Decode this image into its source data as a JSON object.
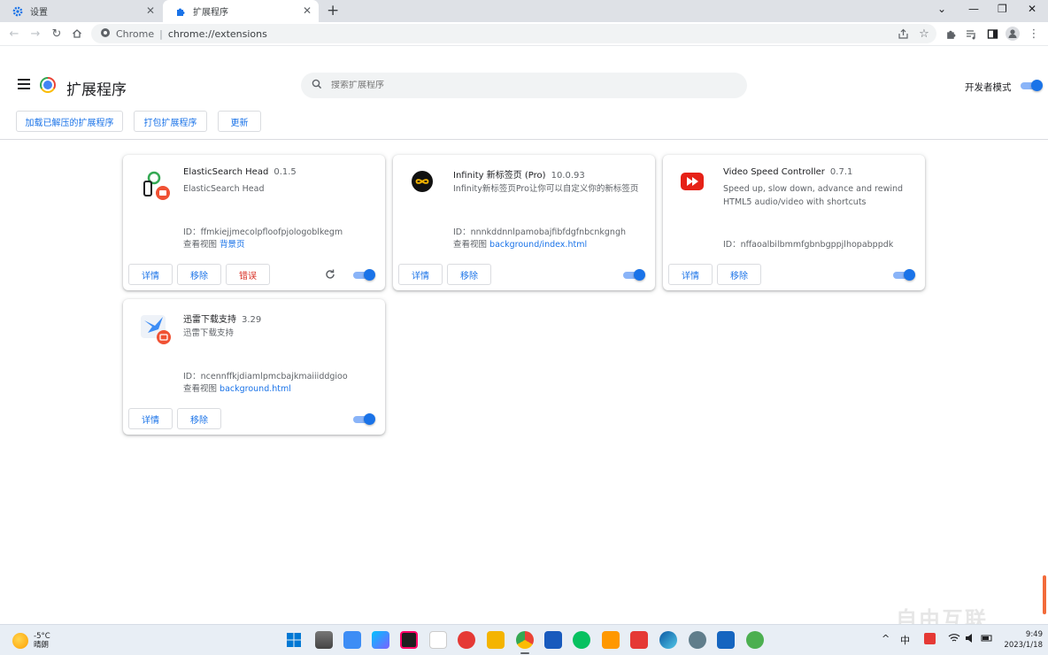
{
  "tabs": [
    {
      "label": "设置",
      "icon": "gear-icon"
    },
    {
      "label": "扩展程序",
      "icon": "puzzle-icon"
    }
  ],
  "omnibox": {
    "origin": "Chrome",
    "url": "chrome://extensions"
  },
  "header": {
    "title": "扩展程序",
    "search_placeholder": "搜索扩展程序",
    "dev_mode_label": "开发者模式",
    "dev_mode_on": true
  },
  "dev_toolbar": {
    "load_unpacked": "加载已解压的扩展程序",
    "pack": "打包扩展程序",
    "update": "更新"
  },
  "extensions": [
    {
      "name": "ElasticSearch Head",
      "version": "0.1.5",
      "description": "ElasticSearch Head",
      "id": "ID：ffmkiejjmecolpfloofpjologoblkegm",
      "views_label": "查看视图",
      "view_link": "背景页",
      "details": "详情",
      "remove": "移除",
      "errors": "错误",
      "enabled": true
    },
    {
      "name": "Infinity 新标签页 (Pro)",
      "version": "10.0.93",
      "description": "Infinity新标签页Pro让你可以自定义你的新标签页",
      "id": "ID：nnnkddnnlpamobajfibfdgfnbcnkgngh",
      "views_label": "查看视图",
      "view_link": "background/index.html",
      "details": "详情",
      "remove": "移除",
      "enabled": true
    },
    {
      "name": "Video Speed Controller",
      "version": "0.7.1",
      "description": "Speed up, slow down, advance and rewind HTML5 audio/video with shortcuts",
      "id": "ID：nffaoalbilbmmfgbnbgppjlhopabppdk",
      "details": "详情",
      "remove": "移除",
      "enabled": true
    },
    {
      "name": "迅雷下载支持",
      "version": "3.29",
      "description": "迅雷下载支持",
      "id": "ID：ncennffkjdiamlpmcbajkmaiiiddgioo",
      "views_label": "查看视图",
      "view_link": "background.html",
      "details": "详情",
      "remove": "移除",
      "enabled": true
    }
  ],
  "taskbar": {
    "temperature": "-5°C",
    "weather": "晴朗",
    "ime": "中",
    "time": "9:49",
    "date": "2023/1/18"
  },
  "watermark": "自由互联",
  "colors": {
    "accent": "#1a73e8",
    "error": "#d93025",
    "tabstrip": "#dee1e6"
  }
}
